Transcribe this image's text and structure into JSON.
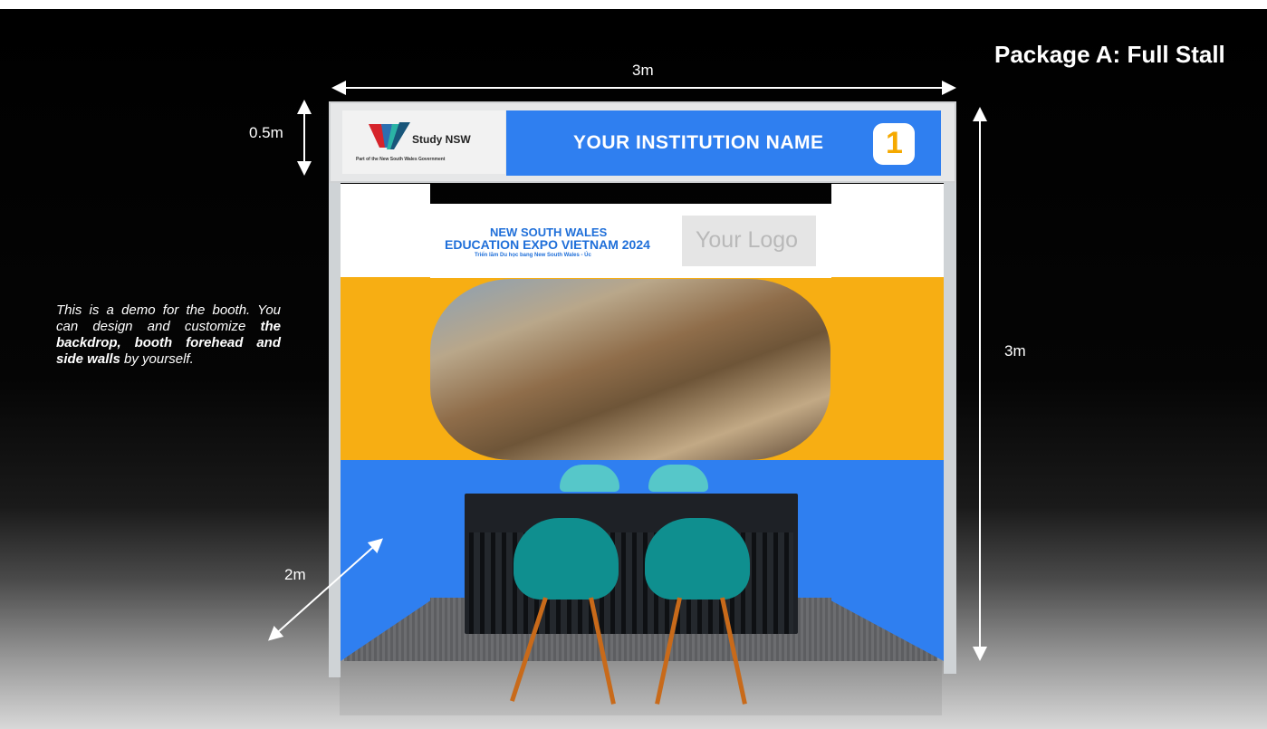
{
  "title": "Package A: Full Stall",
  "dimensions": {
    "width": "3m",
    "height": "3m",
    "fascia_height": "0.5m",
    "depth": "2m"
  },
  "note": {
    "part1": "This is a demo for the booth. You can design and customize ",
    "bold": "the backdrop, booth forehead and side walls",
    "part2": " by yourself."
  },
  "fascia": {
    "logo_name": "Study NSW",
    "logo_subtitle": "Part of the New South Wales Government",
    "institution_name": "YOUR INSTITUTION NAME",
    "booth_number": "1"
  },
  "backdrop": {
    "expo_line1": "NEW SOUTH WALES",
    "expo_line2": "EDUCATION EXPO VIETNAM 2024",
    "expo_line3": "Triển lãm Du học bang New South Wales - Úc",
    "logo_placeholder": "Your Logo"
  },
  "colors": {
    "accent_blue": "#2f7ff0",
    "accent_yellow": "#f7ae13"
  }
}
